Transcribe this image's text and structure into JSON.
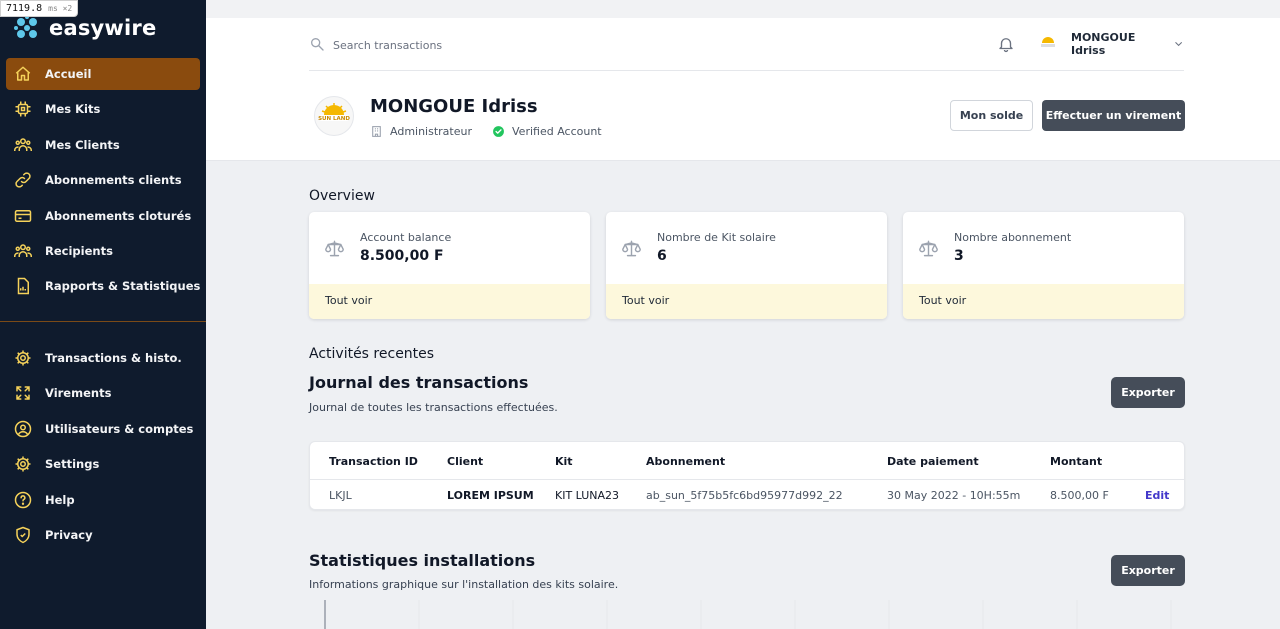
{
  "perf_badge": {
    "value": "7119.8",
    "unit": "ms ×2"
  },
  "brand": {
    "name": "easywire"
  },
  "sidebar": {
    "primary": [
      {
        "label": "Accueil",
        "icon": "home-icon",
        "active": true
      },
      {
        "label": "Mes Kits",
        "icon": "chip-icon"
      },
      {
        "label": "Mes Clients",
        "icon": "users-icon"
      },
      {
        "label": "Abonnements clients",
        "icon": "link-icon"
      },
      {
        "label": "Abonnements cloturés",
        "icon": "credit-card-icon"
      },
      {
        "label": "Recipients",
        "icon": "user-group-icon"
      },
      {
        "label": "Rapports & Statistiques",
        "icon": "document-report-icon"
      }
    ],
    "secondary": [
      {
        "label": "Transactions & histo.",
        "icon": "gear-icon"
      },
      {
        "label": "Virements",
        "icon": "arrows-expand-icon"
      },
      {
        "label": "Utilisateurs & comptes",
        "icon": "user-circle-icon"
      },
      {
        "label": "Settings",
        "icon": "gear-icon"
      },
      {
        "label": "Help",
        "icon": "help-circle-icon"
      },
      {
        "label": "Privacy",
        "icon": "shield-check-icon"
      }
    ]
  },
  "search": {
    "placeholder": "Search transactions"
  },
  "user_menu": {
    "name": "MONGOUE Idriss"
  },
  "profile": {
    "name": "MONGOUE Idriss",
    "role": "Administrateur",
    "status": "Verified Account",
    "logo_text": "SUN LAND"
  },
  "actions": {
    "balance_button": "Mon solde",
    "transfer_button": "Effectuer un virement"
  },
  "overview": {
    "title": "Overview",
    "cards": [
      {
        "label": "Account balance",
        "value": "8.500,00 F",
        "link": "Tout voir",
        "icon": "scale-icon"
      },
      {
        "label": "Nombre de Kit solaire",
        "value": "6",
        "link": "Tout voir",
        "icon": "scale-icon"
      },
      {
        "label": "Nombre abonnement",
        "value": "3",
        "link": "Tout voir",
        "icon": "scale-icon"
      }
    ]
  },
  "activities": {
    "title": "Activités recentes"
  },
  "journal": {
    "title": "Journal des transactions",
    "subtitle": "Journal de toutes les transactions effectuées.",
    "export_label": "Exporter",
    "columns": [
      "Transaction ID",
      "Client",
      "Kit",
      "Abonnement",
      "Date paiement",
      "Montant"
    ],
    "rows": [
      {
        "id": "LKJL",
        "client": "LOREM IPSUM",
        "kit": "KIT LUNA23",
        "abonnement": "ab_sun_5f75b5fc6bd95977d992_22",
        "date": "30 May 2022 - 10H:55m",
        "montant": "8.500,00 F",
        "action": "Edit"
      }
    ]
  },
  "stats": {
    "title": "Statistiques installations",
    "subtitle": "Informations graphique sur l'installation des kits solaire.",
    "export_label": "Exporter"
  },
  "colors": {
    "sidebar_bg": "#0f1b2d",
    "active_bg": "#8a4b0e",
    "icon_yellow": "#f5d25a",
    "primary_button": "#454d59",
    "card_footer": "#fdf8dc",
    "verified_green": "#22c55e",
    "edit_link": "#4338ca"
  }
}
